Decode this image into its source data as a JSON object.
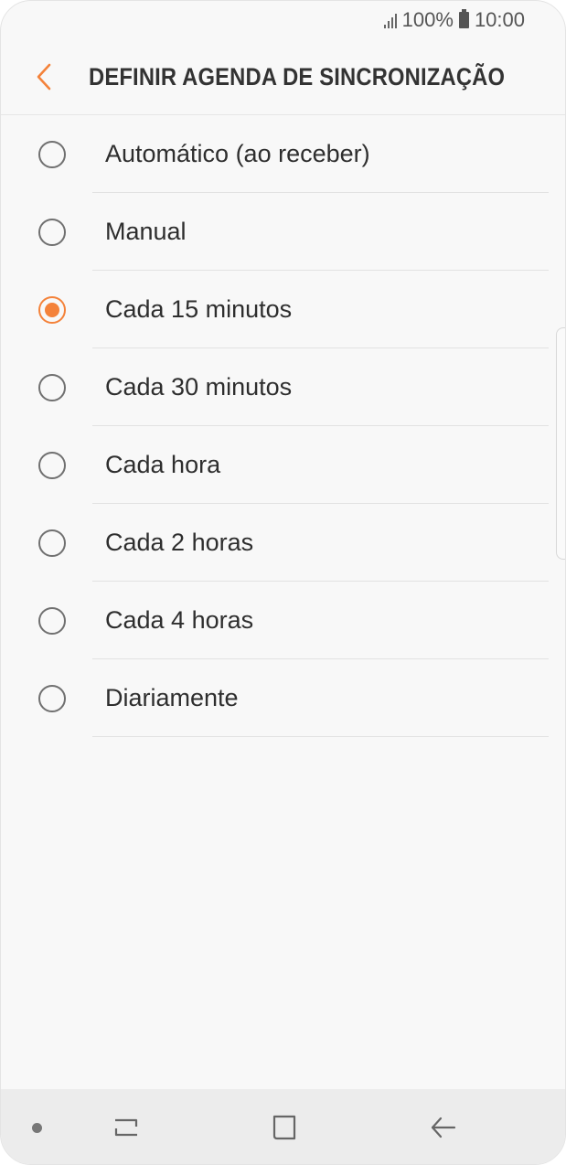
{
  "status_bar": {
    "battery_level": "100%",
    "time": "10:00",
    "signal_icon": "signal-icon",
    "battery_icon": "battery-icon"
  },
  "header": {
    "title": "DEFINIR AGENDA DE SINCRONIZAÇÃO",
    "back_icon": "chevron-left-icon"
  },
  "colors": {
    "accent": "#f4823a",
    "background": "#f8f8f8",
    "text": "#2e2e2e"
  },
  "options": [
    {
      "label": "Automático (ao receber)",
      "selected": false
    },
    {
      "label": "Manual",
      "selected": false
    },
    {
      "label": "Cada 15 minutos",
      "selected": true
    },
    {
      "label": "Cada 30 minutos",
      "selected": false
    },
    {
      "label": "Cada hora",
      "selected": false
    },
    {
      "label": "Cada 2 horas",
      "selected": false
    },
    {
      "label": "Cada 4 horas",
      "selected": false
    },
    {
      "label": "Diariamente",
      "selected": false
    }
  ],
  "nav_bar": {
    "recents_icon": "recents-icon",
    "home_icon": "home-icon",
    "back_icon": "back-arrow-icon"
  }
}
